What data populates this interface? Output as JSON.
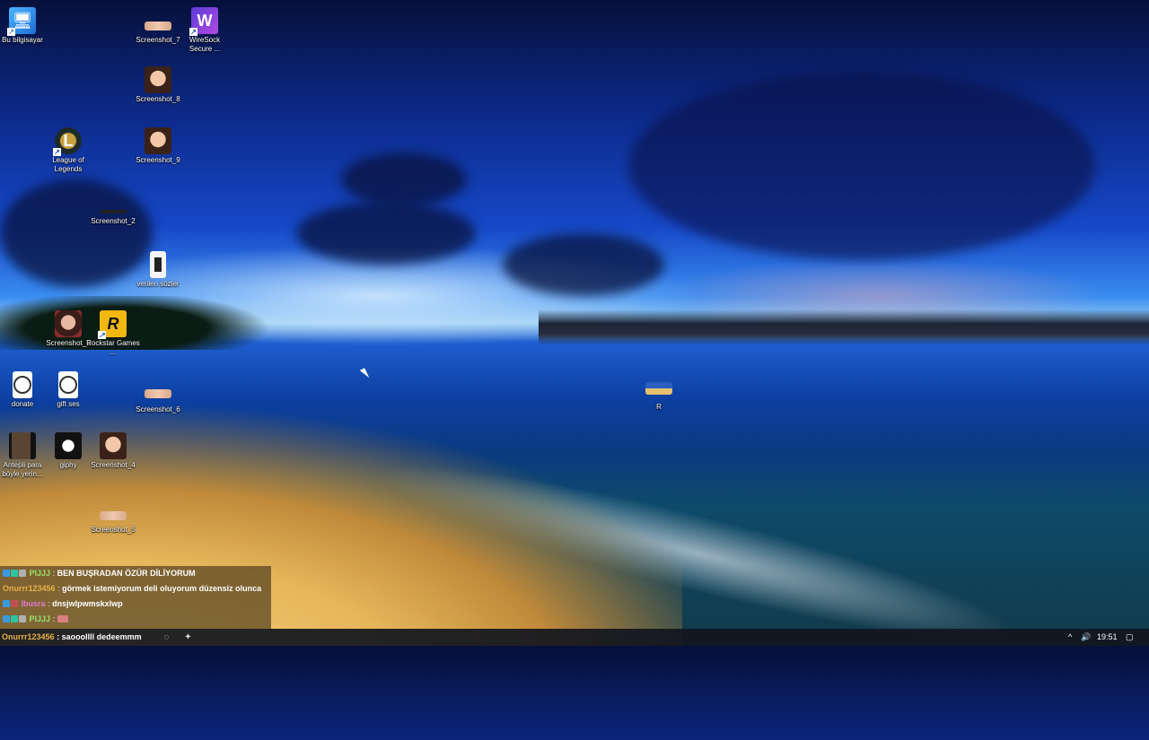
{
  "desktop": {
    "icons": [
      {
        "id": "bu-bilgisayar",
        "label": "Bu bilgisayar",
        "glyph": "🖥"
      },
      {
        "id": "screenshot-7",
        "label": "Screenshot_7"
      },
      {
        "id": "wiresock",
        "label": "WireSock Secure ..."
      },
      {
        "id": "screenshot-8",
        "label": "Screenshot_8"
      },
      {
        "id": "league",
        "label": "League of Legends"
      },
      {
        "id": "screenshot-9",
        "label": "Screenshot_9"
      },
      {
        "id": "screenshot-2",
        "label": "Screenshot_2"
      },
      {
        "id": "verilen-sozler",
        "label": "verilen sözler"
      },
      {
        "id": "screenshot-3",
        "label": "Screenshot_3"
      },
      {
        "id": "rockstar",
        "label": "Rockstar Games ..."
      },
      {
        "id": "donate",
        "label": "donate"
      },
      {
        "id": "gift-ses",
        "label": "gift ses"
      },
      {
        "id": "screenshot-6",
        "label": "Screenshot_6"
      },
      {
        "id": "r",
        "label": "R"
      },
      {
        "id": "antepli",
        "label": "Antepli para böyle yerin..."
      },
      {
        "id": "giphy",
        "label": "giphy"
      },
      {
        "id": "screenshot-4",
        "label": "Screenshot_4"
      },
      {
        "id": "screenshot-5",
        "label": "Screenshot_5"
      }
    ]
  },
  "chat": {
    "messages": [
      {
        "user": "PIJJJ",
        "text": "BEN BUŞRADAN ÖZÜR DİLİYORUM",
        "user_color": "#9be26b"
      },
      {
        "user": "Onurrr123456",
        "text": "görmek istemiyorum deli oluyorum düzensiz olunca",
        "user_color": "#e6b04a"
      },
      {
        "user": "Ibusra",
        "text": "dnsjwlpwmskxlwp",
        "user_color": "#e07ad0"
      },
      {
        "user": "PIJJJ",
        "text": "",
        "user_color": "#9be26b"
      }
    ],
    "taskbar_line": {
      "user": "Onurrr123456",
      "text": "saooollll dedeemmm",
      "user_color": "#e6b04a"
    }
  },
  "taskbar": {
    "clock": "19:51",
    "tray_chevron": "^",
    "volume_icon": "🔊",
    "notification_icon": "▢"
  }
}
